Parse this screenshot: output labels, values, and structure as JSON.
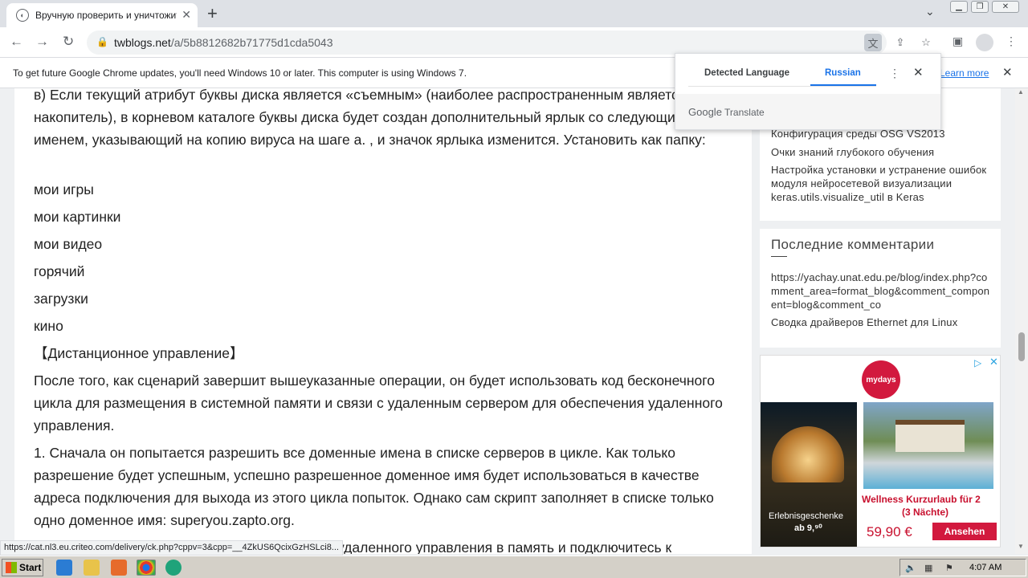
{
  "browser": {
    "tab_title": "Вручную проверить и уничтожить",
    "url_host": "twblogs.net",
    "url_path": "/a/5b8812682b71775d1cda5043",
    "infobar_message": "To get future Google Chrome updates, you'll need Windows 10 or later. This computer is using Windows 7.",
    "infobar_link": "Learn more",
    "status_url": "https://cat.nl3.eu.criteo.com/delivery/ck.php?cppv=3&cpp=__4ZkUS6QcixGzHSLci8..."
  },
  "translate_popup": {
    "tab_detected": "Detected Language",
    "tab_target": "Russian",
    "footer_brand": "Google",
    "footer_product": "Translate"
  },
  "article": {
    "paragraphs": [
      "в) Если текущий атрибут буквы диска является «съемным» (наиболее распространенным является USB-накопитель), в корневом каталоге буквы диска будет создан дополнительный ярлык со следующим именем, указывающий на копию вируса на шаге a. , и значок ярлыка изменится. Установить как папку:",
      "мои игры",
      "мои картинки",
      "мои видео",
      "горячий",
      "загрузки",
      "кино",
      "【Дистанционное управление】",
      "После того, как сценарий завершит вышеуказанные операции, он будет использовать код бесконечного цикла для размещения в системной памяти и связи с удаленным сервером для обеспечения удаленного управления.",
      "1. Сначала он попытается разрешить все доменные имена в списке серверов в цикле. Как только разрешение будет успешным, успешно разрешенное доменное имя будет использоваться в качестве адреса подключения для выхода из этого цикла попыток. Однако сам скрипт заполняет в списке только одно доменное имя: superyou.zapto.org.",
      "удаленного управления в память и подключитесь к"
    ]
  },
  "sidebar": {
    "recent_posts": [
      "Конфигурация среды OSG VS2013",
      "Очки знаний глубокого обучения",
      "Настройка установки и устранение ошибок модуля нейросетевой визуализации keras.utils.visualize_util в Keras"
    ],
    "comments_title": "Последние комментарии",
    "comments": [
      "https://yachay.unat.edu.pe/blog/index.php?comment_area=format_blog&comment_component=blog&comment_co",
      "Сводка драйверов Ethernet для Linux"
    ]
  },
  "ad": {
    "brand": "mydays",
    "caption_left_1": "Erlebnisgeschenke",
    "caption_left_2": "ab 9,⁹⁰",
    "headline_1": "Wellness Kurzurlaub für 2",
    "headline_2": "(3 Nächte)",
    "price": "59,90 €",
    "cta": "Ansehen"
  },
  "taskbar": {
    "start_label": "Start",
    "clock": "4:07 AM"
  }
}
